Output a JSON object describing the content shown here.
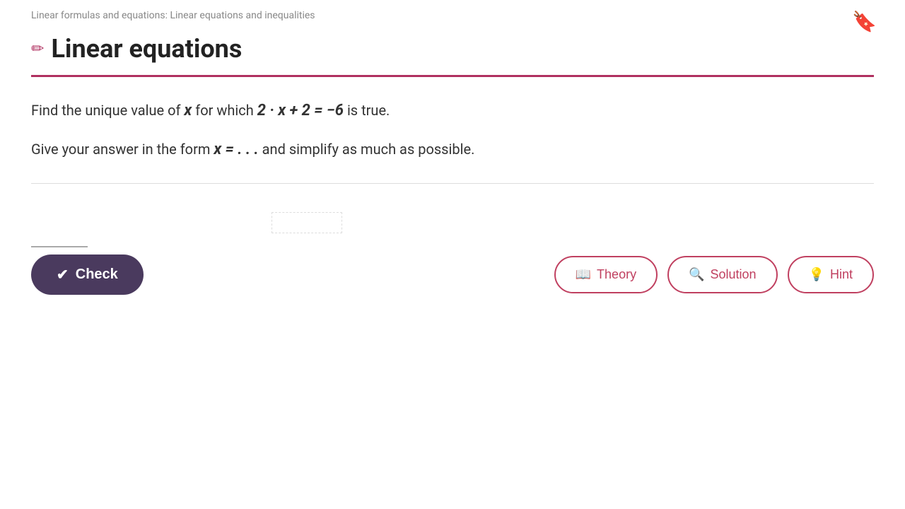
{
  "breadcrumb": {
    "text": "Linear formulas and equations: Linear equations and inequalities"
  },
  "page_title": "Linear equations",
  "pencil_icon": "✏",
  "bookmark_icon": "🔖",
  "problem": {
    "line1_pre": "Find the unique value of ",
    "line1_x": "x",
    "line1_mid": " for which ",
    "line1_eq": "2 · x + 2 = −6",
    "line1_post": " is true.",
    "line2_pre": "Give your answer in the form ",
    "line2_eq": "x = . . .",
    "line2_post": " and simplify as much as possible."
  },
  "check_button": {
    "label": "Check",
    "icon": "✔"
  },
  "buttons": {
    "theory": {
      "label": "Theory",
      "icon": "📖"
    },
    "solution": {
      "label": "Solution",
      "icon": "🔍"
    },
    "hint": {
      "label": "Hint",
      "icon": "💡"
    }
  },
  "answer_input": {
    "value": "",
    "placeholder": ""
  }
}
